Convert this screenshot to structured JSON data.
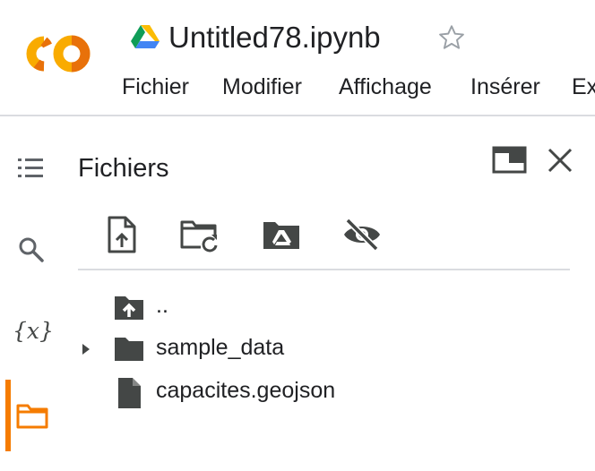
{
  "header": {
    "logo_text": "CO",
    "document_title": "Untitled78.ipynb",
    "menu": [
      "Fichier",
      "Modifier",
      "Affichage",
      "Insérer",
      "Ex"
    ]
  },
  "icons": {
    "logo": "colab-logo",
    "drive": "google-drive-icon",
    "star": "star-outline-icon",
    "toc": "table-of-contents-icon",
    "search": "search-icon",
    "variables": "variables-icon",
    "files": "folder-outline-icon",
    "expand": "open-in-tab-icon",
    "close": "close-icon",
    "upload": "upload-file-icon",
    "refresh": "folder-refresh-icon",
    "mount_drive": "drive-folder-icon",
    "hide": "visibility-off-icon",
    "parent": "folder-upload-icon",
    "folder": "folder-icon",
    "file": "file-icon"
  },
  "sidebar": {
    "variables_glyph": "{x}",
    "active_item": "files"
  },
  "panel": {
    "title": "Fichiers",
    "entries": [
      {
        "label": "..",
        "kind": "parent"
      },
      {
        "label": "sample_data",
        "kind": "folder",
        "expanded": false
      },
      {
        "label": "capacites.geojson",
        "kind": "file"
      }
    ]
  },
  "colors": {
    "accent_orange": "#f57c00",
    "logo_yellow": "#f9ab00",
    "icon_gray": "#5f6368",
    "divider": "#dadce0"
  }
}
